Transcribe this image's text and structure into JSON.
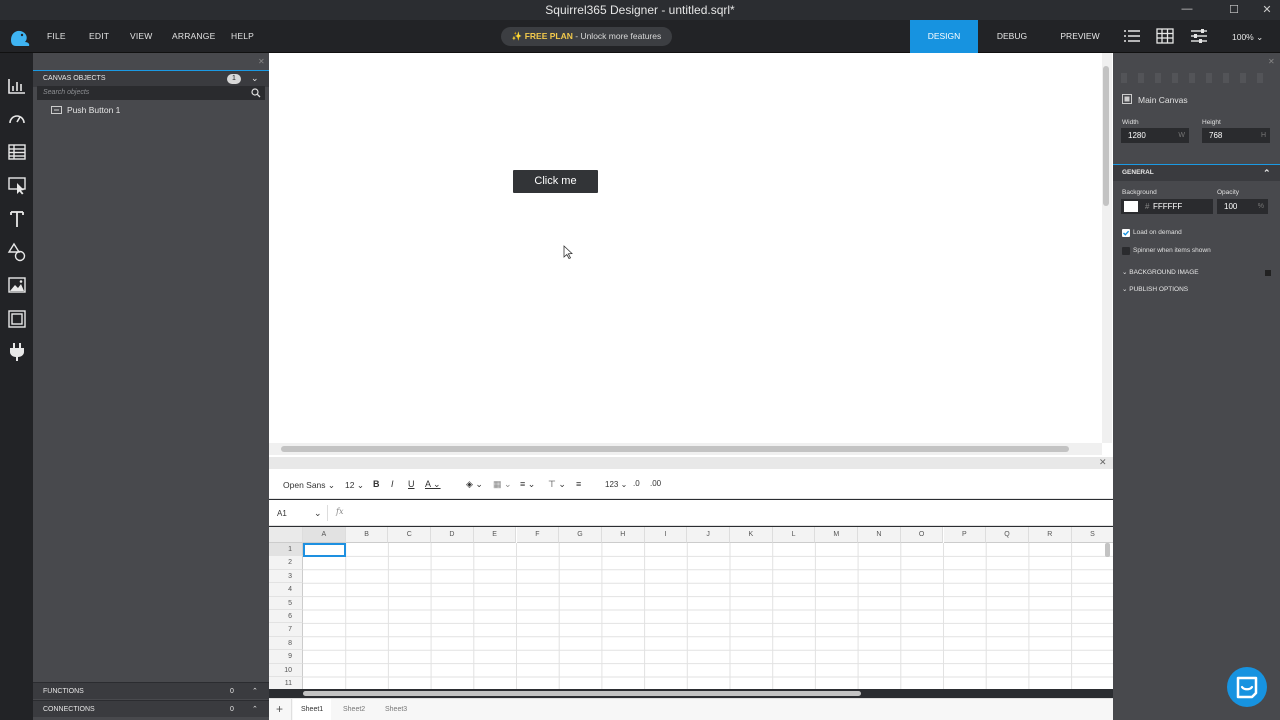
{
  "window": {
    "title": "Squirrel365 Designer - untitled.sqrl*"
  },
  "menu": {
    "file": "FILE",
    "edit": "EDIT",
    "view": "VIEW",
    "arrange": "ARRANGE",
    "help": "HELP"
  },
  "plan": {
    "badge": "✨ FREE PLAN",
    "rest": " - Unlock more features"
  },
  "modes": {
    "design": "DESIGN",
    "debug": "DEBUG",
    "preview": "PREVIEW"
  },
  "zoom": "100%",
  "objects_panel": {
    "header": "CANVAS OBJECTS",
    "count": "1",
    "search_placeholder": "Search objects",
    "items": [
      {
        "label": "Push Button 1"
      }
    ],
    "functions_label": "FUNCTIONS",
    "functions_count": "0",
    "connections_label": "CONNECTIONS",
    "connections_count": "0"
  },
  "canvas": {
    "button_label": "Click me"
  },
  "spreadsheet": {
    "font": "Open Sans",
    "size": "12",
    "number_format": "123",
    "cell_ref": "A1",
    "fx": "fx",
    "columns": [
      "A",
      "B",
      "C",
      "D",
      "E",
      "F",
      "G",
      "H",
      "I",
      "J",
      "K",
      "L",
      "M",
      "N",
      "O",
      "P",
      "Q",
      "R",
      "S"
    ],
    "rows": [
      "1",
      "2",
      "3",
      "4",
      "5",
      "6",
      "7",
      "8",
      "9",
      "10",
      "11"
    ],
    "sheets": [
      "Sheet1",
      "Sheet2",
      "Sheet3"
    ]
  },
  "properties": {
    "canvas_name": "Main Canvas",
    "width_label": "Width",
    "width_value": "1280",
    "width_suffix": "W",
    "height_label": "Height",
    "height_value": "768",
    "height_suffix": "H",
    "general": "GENERAL",
    "background_label": "Background",
    "background_hash": "#",
    "background_value": "FFFFFF",
    "opacity_label": "Opacity",
    "opacity_value": "100",
    "opacity_suffix": "%",
    "load_on_demand": "Load on demand",
    "spinner": "Spinner when items shown",
    "background_image": "BACKGROUND IMAGE",
    "publish_options": "PUBLISH OPTIONS"
  },
  "colors": {
    "accent": "#1793e0",
    "plan_text": "#f2c94c",
    "panel": "#48494d",
    "dark": "#222326"
  }
}
